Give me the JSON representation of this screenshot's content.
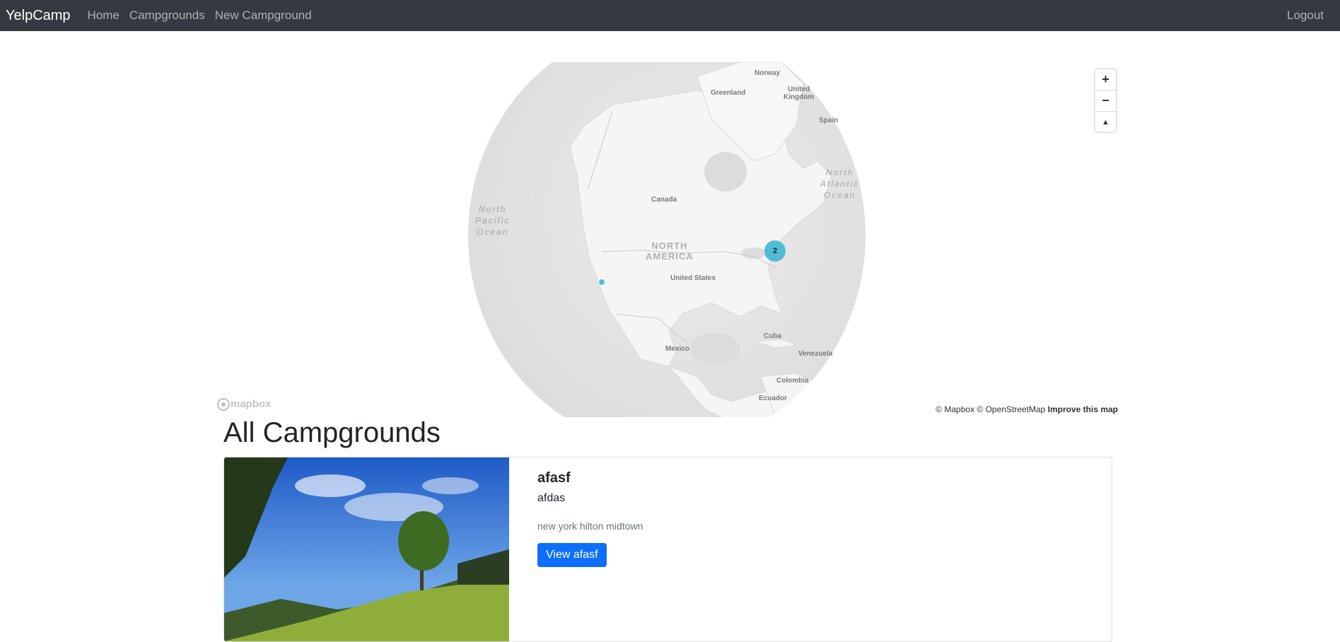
{
  "navbar": {
    "brand": "YelpCamp",
    "links": [
      "Home",
      "Campgrounds",
      "New Campground"
    ],
    "logout": "Logout"
  },
  "map": {
    "labels": {
      "norway": "Norway",
      "greenland": "Greenland",
      "united_kingdom": "United\nKingdom",
      "spain": "Spain",
      "north_atlantic": "North\nAtlantic\nOcean",
      "north_pacific": "North\nPacific\nOcean",
      "canada": "Canada",
      "north_america": "NORTH\nAMERICA",
      "united_states": "United States",
      "cuba": "Cuba",
      "venezuela": "Venezuela",
      "mexico": "Mexico",
      "colombia": "Colombia",
      "ecuador": "Ecuador"
    },
    "cluster_count": "2",
    "controls": {
      "zoom_in": "+",
      "zoom_out": "−",
      "compass": "▲"
    },
    "logo_text": "mapbox",
    "attribution": {
      "copyright": "© Mapbox © OpenStreetMap",
      "improve": "Improve this map"
    },
    "colors": {
      "land": "#f4f4f4",
      "ocean": "#e6e6e6",
      "cluster": "#51bbd6"
    }
  },
  "page": {
    "heading": "All Campgrounds"
  },
  "campgrounds": [
    {
      "title": "afasf",
      "description": "afdas",
      "location": "new york hilton midtown",
      "button": "View afasf"
    }
  ]
}
